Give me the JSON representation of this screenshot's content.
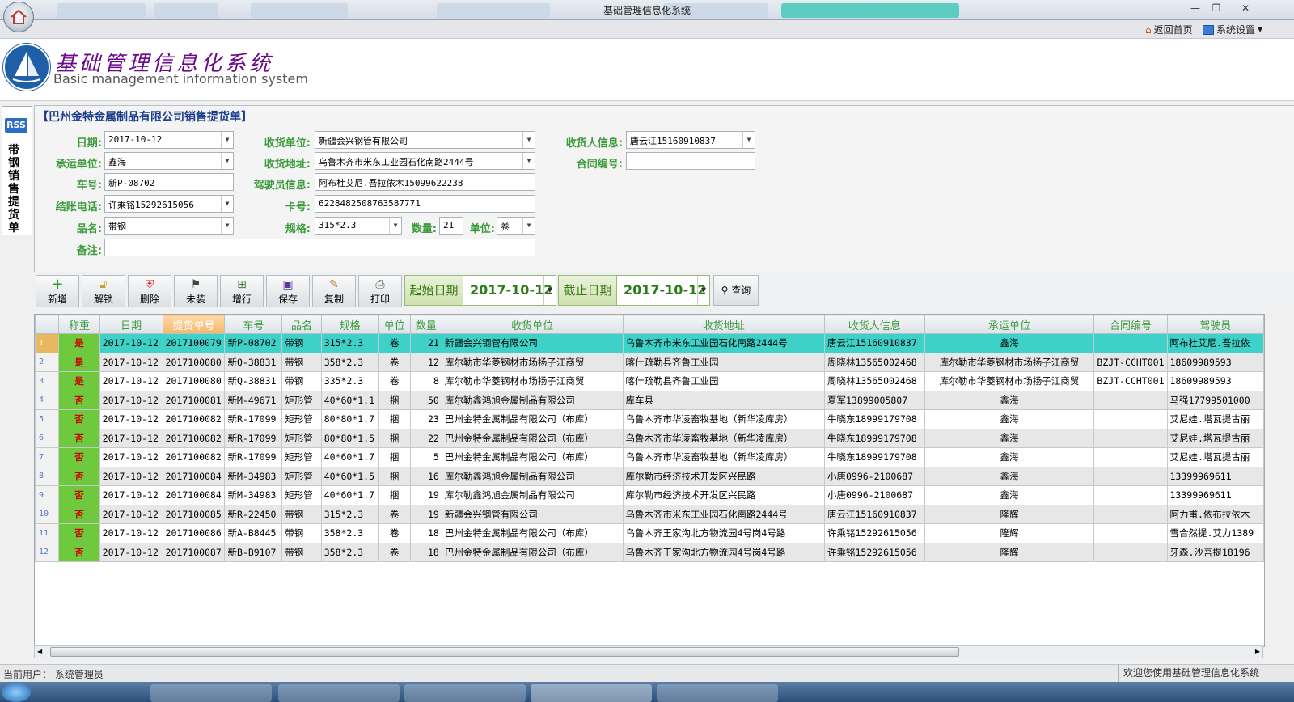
{
  "window": {
    "title": "基础管理信息化系统"
  },
  "menubar": {
    "back_home": "返回首页",
    "system_settings": "系统设置"
  },
  "header": {
    "title_cn": "基础管理信息化系统",
    "title_en": "Basic management information system"
  },
  "side": {
    "rss": "RSS",
    "tab_label": "带钢销售提货单"
  },
  "form": {
    "title": "【巴州金特金属制品有限公司销售提货单】",
    "labels": {
      "date": "日期:",
      "carrier": "承运单位:",
      "plate": "车号:",
      "billing_phone": "结账电话:",
      "product": "品名:",
      "remark": "备注:",
      "receiver_unit": "收货单位:",
      "receiver_address": "收货地址:",
      "driver_info": "驾驶员信息:",
      "card_no": "卡号:",
      "spec": "规格:",
      "quantity": "数量:",
      "unit": "单位:",
      "receiver_info": "收货人信息:",
      "contract_no": "合同编号:"
    },
    "values": {
      "date": "2017-10-12",
      "carrier": "鑫海",
      "plate": "新P-08702",
      "billing_phone": "许乘铭15292615056",
      "product": "带钢",
      "remark": "",
      "receiver_unit": "新疆会兴钢管有限公司",
      "receiver_address": "乌鲁木齐市米东工业园石化南路2444号",
      "driver_info": "阿布杜艾尼.吾拉依木15099622238",
      "card_no": "6228482508763587771",
      "spec": "315*2.3",
      "quantity": "21",
      "unit": "卷",
      "receiver_info": "唐云江15160910837",
      "contract_no": ""
    }
  },
  "toolbar": {
    "buttons": [
      {
        "label": "新增",
        "icon": "add-icon"
      },
      {
        "label": "解锁",
        "icon": "unlock-icon"
      },
      {
        "label": "删除",
        "icon": "delete-icon"
      },
      {
        "label": "未装",
        "icon": "traffic-light-icon"
      },
      {
        "label": "增行",
        "icon": "add-row-icon"
      },
      {
        "label": "保存",
        "icon": "save-icon"
      },
      {
        "label": "复制",
        "icon": "copy-icon"
      },
      {
        "label": "打印",
        "icon": "print-icon"
      }
    ],
    "start_label": "起始日期",
    "start_date": "2017-10-12",
    "end_label": "截止日期",
    "end_date": "2017-10-12",
    "query_label": "查询"
  },
  "grid": {
    "columns": [
      "称重",
      "日期",
      "提货单号",
      "车号",
      "品名",
      "规格",
      "单位",
      "数量",
      "收货单位",
      "收货地址",
      "收货人信息",
      "承运单位",
      "合同编号",
      "驾驶员"
    ],
    "rows": [
      {
        "n": "1",
        "w": "是",
        "date": "2017-10-12",
        "no": "2017100079",
        "plate": "新P-08702",
        "prod": "带钢",
        "spec": "315*2.3",
        "unit": "卷",
        "qty": "21",
        "recv": "新疆会兴钢管有限公司",
        "addr": "乌鲁木齐市米东工业园石化南路2444号",
        "person": "唐云江15160910837",
        "carrier": "鑫海",
        "contract": "",
        "driver": "阿布杜艾尼.吾拉依"
      },
      {
        "n": "2",
        "w": "是",
        "date": "2017-10-12",
        "no": "2017100080",
        "plate": "新Q-38831",
        "prod": "带钢",
        "spec": "358*2.3",
        "unit": "卷",
        "qty": "12",
        "recv": "库尔勒市华菱钢材市场扬子江商贸",
        "addr": "喀什疏勒县齐鲁工业园",
        "person": "周晓林13565002468",
        "carrier": "库尔勒市华菱钢材市场扬子江商贸",
        "contract": "BZJT-CCHT001",
        "driver": "18609989593"
      },
      {
        "n": "3",
        "w": "是",
        "date": "2017-10-12",
        "no": "2017100080",
        "plate": "新Q-38831",
        "prod": "带钢",
        "spec": "335*2.3",
        "unit": "卷",
        "qty": "8",
        "recv": "库尔勒市华菱钢材市场扬子江商贸",
        "addr": "喀什疏勒县齐鲁工业园",
        "person": "周晓林13565002468",
        "carrier": "库尔勒市华菱钢材市场扬子江商贸",
        "contract": "BZJT-CCHT001",
        "driver": "18609989593"
      },
      {
        "n": "4",
        "w": "否",
        "date": "2017-10-12",
        "no": "2017100081",
        "plate": "新M-49671",
        "prod": "矩形管",
        "spec": "40*60*1.1",
        "unit": "捆",
        "qty": "50",
        "recv": "库尔勒鑫鸿旭金属制品有限公司",
        "addr": "库车县",
        "person": "夏军13899005807",
        "carrier": "鑫海",
        "contract": "",
        "driver": "马强17799501000"
      },
      {
        "n": "5",
        "w": "否",
        "date": "2017-10-12",
        "no": "2017100082",
        "plate": "新R-17099",
        "prod": "矩形管",
        "spec": "80*80*1.7",
        "unit": "捆",
        "qty": "23",
        "recv": "巴州金特金属制品有限公司（布库）",
        "addr": "乌鲁木齐市华凌畜牧基地（新华凌库房）",
        "person": "牛晓东18999179708",
        "carrier": "鑫海",
        "contract": "",
        "driver": "艾尼娃.塔瓦提古丽"
      },
      {
        "n": "6",
        "w": "否",
        "date": "2017-10-12",
        "no": "2017100082",
        "plate": "新R-17099",
        "prod": "矩形管",
        "spec": "80*80*1.5",
        "unit": "捆",
        "qty": "22",
        "recv": "巴州金特金属制品有限公司（布库）",
        "addr": "乌鲁木齐市华凌畜牧基地（新华凌库房）",
        "person": "牛晓东18999179708",
        "carrier": "鑫海",
        "contract": "",
        "driver": "艾尼娃.塔瓦提古丽"
      },
      {
        "n": "7",
        "w": "否",
        "date": "2017-10-12",
        "no": "2017100082",
        "plate": "新R-17099",
        "prod": "矩形管",
        "spec": "40*60*1.7",
        "unit": "捆",
        "qty": "5",
        "recv": "巴州金特金属制品有限公司（布库）",
        "addr": "乌鲁木齐市华凌畜牧基地（新华凌库房）",
        "person": "牛晓东18999179708",
        "carrier": "鑫海",
        "contract": "",
        "driver": "艾尼娃.塔瓦提古丽"
      },
      {
        "n": "8",
        "w": "否",
        "date": "2017-10-12",
        "no": "2017100084",
        "plate": "新M-34983",
        "prod": "矩形管",
        "spec": "40*60*1.5",
        "unit": "捆",
        "qty": "16",
        "recv": "库尔勒鑫鸿旭金属制品有限公司",
        "addr": "库尔勒市经济技术开发区兴民路",
        "person": "小唐0996-2100687",
        "carrier": "鑫海",
        "contract": "",
        "driver": "13399969611"
      },
      {
        "n": "9",
        "w": "否",
        "date": "2017-10-12",
        "no": "2017100084",
        "plate": "新M-34983",
        "prod": "矩形管",
        "spec": "40*60*1.7",
        "unit": "捆",
        "qty": "19",
        "recv": "库尔勒鑫鸿旭金属制品有限公司",
        "addr": "库尔勒市经济技术开发区兴民路",
        "person": "小唐0996-2100687",
        "carrier": "鑫海",
        "contract": "",
        "driver": "13399969611"
      },
      {
        "n": "10",
        "w": "否",
        "date": "2017-10-12",
        "no": "2017100085",
        "plate": "新R-22450",
        "prod": "带钢",
        "spec": "315*2.3",
        "unit": "卷",
        "qty": "19",
        "recv": "新疆会兴钢管有限公司",
        "addr": "乌鲁木齐市米东工业园石化南路2444号",
        "person": "唐云江15160910837",
        "carrier": "隆辉",
        "contract": "",
        "driver": "阿力甫.依布拉依木"
      },
      {
        "n": "11",
        "w": "否",
        "date": "2017-10-12",
        "no": "2017100086",
        "plate": "新A-B8445",
        "prod": "带钢",
        "spec": "358*2.3",
        "unit": "卷",
        "qty": "18",
        "recv": "巴州金特金属制品有限公司（布库）",
        "addr": "乌鲁木齐王家沟北方物流园4号岗4号路",
        "person": "许乘铭15292615056",
        "carrier": "隆辉",
        "contract": "",
        "driver": "雪合然提.艾力1389"
      },
      {
        "n": "12",
        "w": "否",
        "date": "2017-10-12",
        "no": "2017100087",
        "plate": "新B-B9107",
        "prod": "带钢",
        "spec": "358*2.3",
        "unit": "卷",
        "qty": "18",
        "recv": "巴州金特金属制品有限公司（布库）",
        "addr": "乌鲁木齐王家沟北方物流园4号岗4号路",
        "person": "许乘铭15292615056",
        "carrier": "隆辉",
        "contract": "",
        "driver": "牙森.沙吾提18196"
      }
    ]
  },
  "status": {
    "current_user": "当前用户：  系统管理员",
    "welcome": "欢迎您使用基础管理信息化系统"
  },
  "colors": {
    "label_green": "#3d9a3d",
    "active_row": "#3dd1c8",
    "check_green": "#6ec93c",
    "title_blue": "#1a3c8a"
  }
}
